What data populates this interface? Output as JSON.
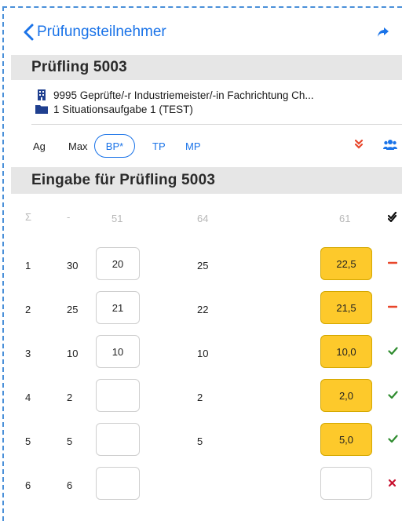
{
  "nav": {
    "back_label": "Prüfungsteilnehmer"
  },
  "candidate": {
    "title": "Prüfling 5003",
    "qualification": "9995 Geprüfte/-r Industriemeister/-in  Fachrichtung Ch...",
    "task": "1 Situationsaufgabe 1 (TEST)"
  },
  "toolbar": {
    "ag": "Ag",
    "max": "Max",
    "bp": "BP*",
    "tp": "TP",
    "mp": "MP"
  },
  "input_section": {
    "title": "Eingabe für Prüfling 5003"
  },
  "sum_row": {
    "idx": "Σ",
    "max": "-",
    "bp": "51",
    "tp": "64",
    "result": "61"
  },
  "rows": [
    {
      "idx": "1",
      "max": "30",
      "bp": "20",
      "tp": "25",
      "result": "22,5",
      "status": "minus"
    },
    {
      "idx": "2",
      "max": "25",
      "bp": "21",
      "tp": "22",
      "result": "21,5",
      "status": "minus"
    },
    {
      "idx": "3",
      "max": "10",
      "bp": "10",
      "tp": "10",
      "result": "10,0",
      "status": "check"
    },
    {
      "idx": "4",
      "max": "2",
      "bp": "",
      "tp": "2",
      "result": "2,0",
      "status": "check"
    },
    {
      "idx": "5",
      "max": "5",
      "bp": "",
      "tp": "5",
      "result": "5,0",
      "status": "check"
    },
    {
      "idx": "6",
      "max": "6",
      "bp": "",
      "tp": "",
      "result": "",
      "status": "cross"
    }
  ],
  "colors": {
    "accent": "#1a73e8",
    "result_fill": "#fdc92b",
    "minus": "#e8462b",
    "check": "#2e8b2e",
    "cross": "#c8102e"
  }
}
